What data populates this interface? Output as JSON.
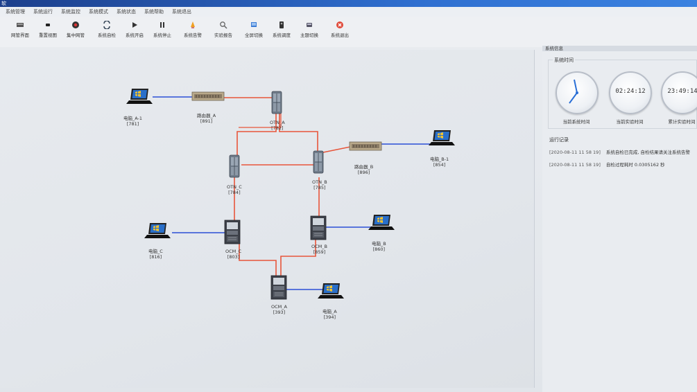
{
  "titlebar": {
    "title": "软"
  },
  "menu": [
    "系统管理",
    "系统运行",
    "系统监控",
    "系统模式",
    "系统状态",
    "系统帮助",
    "系统退出"
  ],
  "toolbar": [
    {
      "label": "网管界面",
      "icon": "network-icon"
    },
    {
      "label": "重置视图",
      "icon": "reset-view-icon"
    },
    {
      "label": "集中网管",
      "icon": "central-manage-icon"
    },
    {
      "label": "系统自检",
      "icon": "self-check-icon"
    },
    {
      "label": "系统开启",
      "icon": "play-icon"
    },
    {
      "label": "系统停止",
      "icon": "pause-icon"
    },
    {
      "label": "系统告警",
      "icon": "alarm-icon"
    },
    {
      "label": "实验报告",
      "icon": "report-icon"
    },
    {
      "label": "全屏切换",
      "icon": "fullscreen-icon"
    },
    {
      "label": "系统调度",
      "icon": "schedule-icon"
    },
    {
      "label": "主题切换",
      "icon": "theme-icon"
    },
    {
      "label": "系统退出",
      "icon": "exit-icon"
    }
  ],
  "topology": {
    "nodes": [
      {
        "id": "pc_a1",
        "label": "电脑_A-1",
        "code": "[781]"
      },
      {
        "id": "router_a",
        "label": "路由器_A",
        "code": "[891]"
      },
      {
        "id": "otn_a",
        "label": "OTN_A",
        "code": "[782]"
      },
      {
        "id": "router_b",
        "label": "路由器_B",
        "code": "[896]"
      },
      {
        "id": "pc_b1",
        "label": "电脑_B-1",
        "code": "[854]"
      },
      {
        "id": "otn_c",
        "label": "OTN_C",
        "code": "[784]"
      },
      {
        "id": "otn_b",
        "label": "OTN_B",
        "code": "[785]"
      },
      {
        "id": "pc_c",
        "label": "电脑_C",
        "code": "[816]"
      },
      {
        "id": "ocm_c",
        "label": "OCM_C",
        "code": "[803]"
      },
      {
        "id": "ocm_b",
        "label": "OCM_B",
        "code": "[859]"
      },
      {
        "id": "pc_b",
        "label": "电脑_B",
        "code": "[860]"
      },
      {
        "id": "ocm_a",
        "label": "OCM_A",
        "code": "[393]"
      },
      {
        "id": "pc_a",
        "label": "电脑_A",
        "code": "[394]"
      }
    ]
  },
  "side_panel": {
    "title": "系统信息",
    "clock_group": "系统时间",
    "clocks": [
      {
        "display": "",
        "caption": "当前系统时间"
      },
      {
        "display": "02:24:12",
        "caption": "当前实验时间"
      },
      {
        "display": "23:49:14",
        "caption": "累计实验时间"
      }
    ],
    "log_group": "运行记录",
    "logs": [
      {
        "time": "[2020-08-11 11 58 19]",
        "text": "系统自检已完成, 自检结果请关注系统告警"
      },
      {
        "time": "[2020-08-11 11 58 19]",
        "text": "自检过程耗时 0.0305162 秒"
      }
    ]
  },
  "colors": {
    "fiber": "#e8553a",
    "ethernet": "#2a4fd6",
    "titlebar": "#2f6fd0"
  }
}
